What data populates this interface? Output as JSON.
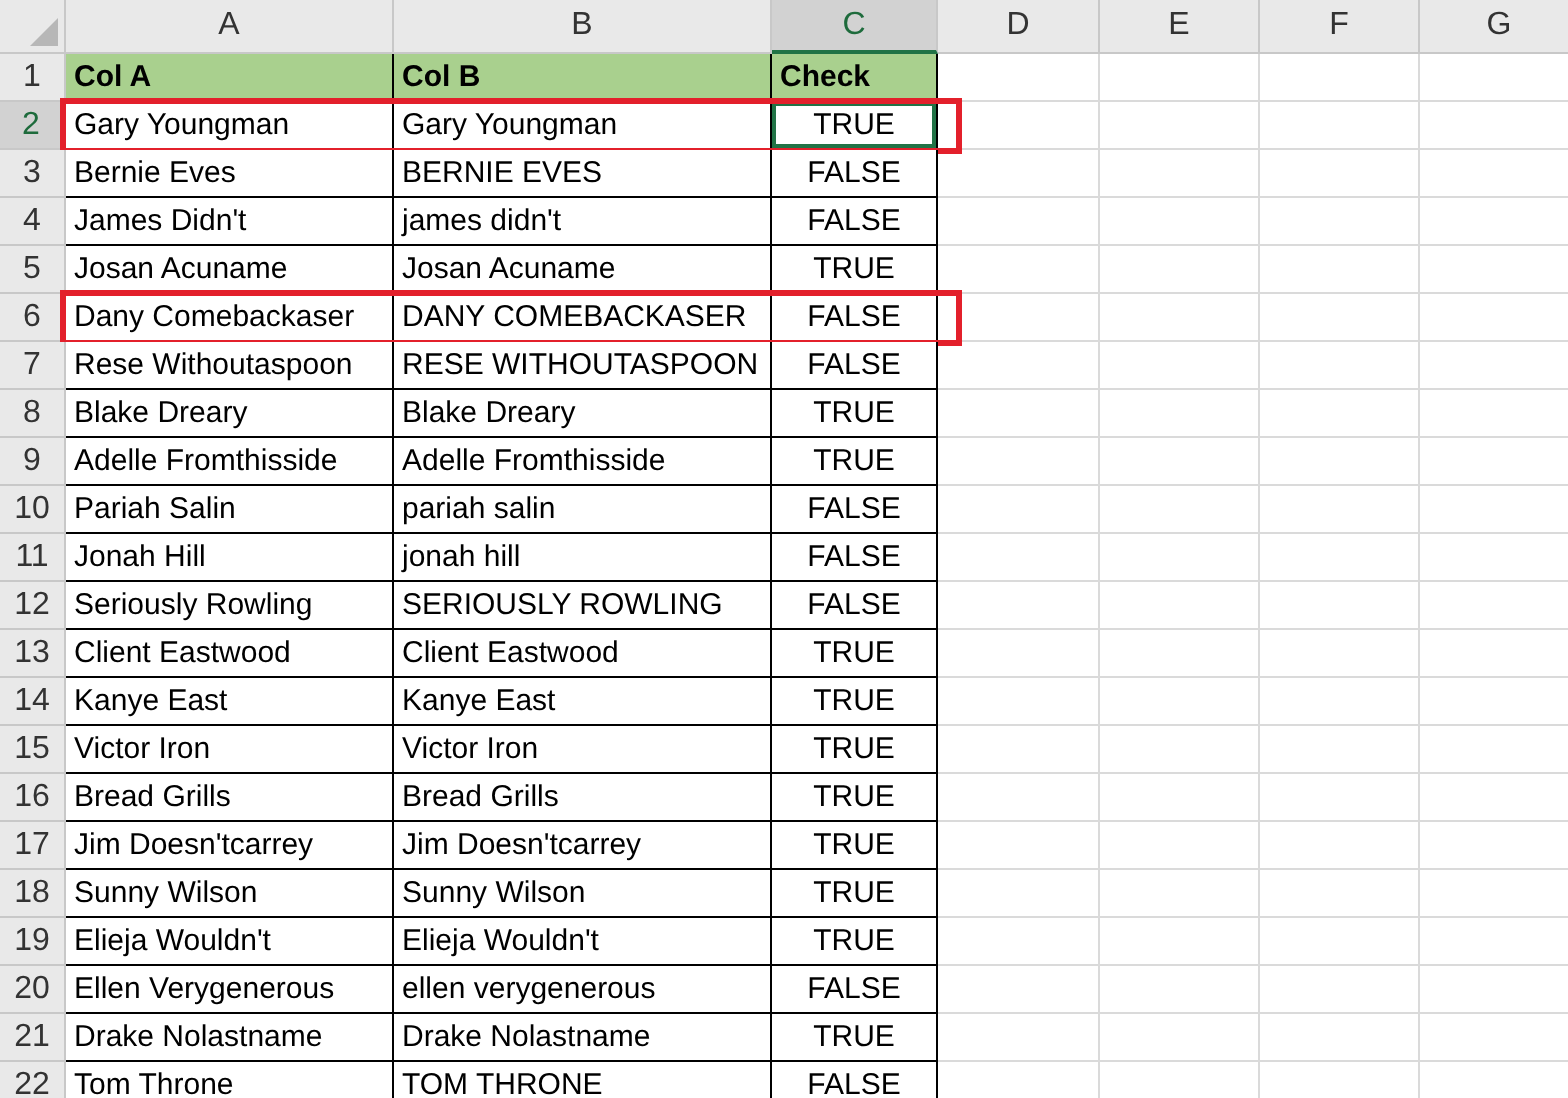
{
  "columns": [
    {
      "label": "A",
      "selected": false
    },
    {
      "label": "B",
      "selected": false
    },
    {
      "label": "C",
      "selected": true
    },
    {
      "label": "D",
      "selected": false
    },
    {
      "label": "E",
      "selected": false
    },
    {
      "label": "F",
      "selected": false
    },
    {
      "label": "G",
      "selected": false
    }
  ],
  "rows": [
    {
      "number": "1",
      "selected": false,
      "outlined": false,
      "kind": "header",
      "cells": [
        "Col A",
        "Col B",
        "Check"
      ]
    },
    {
      "number": "2",
      "selected": true,
      "outlined": true,
      "kind": "data",
      "cells": [
        "Gary Youngman",
        "Gary Youngman",
        "TRUE"
      ]
    },
    {
      "number": "3",
      "selected": false,
      "outlined": false,
      "kind": "data",
      "cells": [
        "Bernie Eves",
        "BERNIE EVES",
        "FALSE"
      ]
    },
    {
      "number": "4",
      "selected": false,
      "outlined": false,
      "kind": "data",
      "cells": [
        "James Didn't",
        "james didn't",
        "FALSE"
      ]
    },
    {
      "number": "5",
      "selected": false,
      "outlined": false,
      "kind": "data",
      "cells": [
        "Josan Acuname",
        "Josan Acuname",
        "TRUE"
      ]
    },
    {
      "number": "6",
      "selected": false,
      "outlined": true,
      "kind": "data",
      "cells": [
        "Dany Comebackaser",
        "DANY COMEBACKASER",
        "FALSE"
      ]
    },
    {
      "number": "7",
      "selected": false,
      "outlined": false,
      "kind": "data",
      "cells": [
        "Rese Withoutaspoon",
        "RESE WITHOUTASPOON",
        "FALSE"
      ]
    },
    {
      "number": "8",
      "selected": false,
      "outlined": false,
      "kind": "data",
      "cells": [
        "Blake Dreary",
        "Blake Dreary",
        "TRUE"
      ]
    },
    {
      "number": "9",
      "selected": false,
      "outlined": false,
      "kind": "data",
      "cells": [
        "Adelle Fromthisside",
        "Adelle Fromthisside",
        "TRUE"
      ]
    },
    {
      "number": "10",
      "selected": false,
      "outlined": false,
      "kind": "data",
      "cells": [
        "Pariah Salin",
        "pariah salin",
        "FALSE"
      ]
    },
    {
      "number": "11",
      "selected": false,
      "outlined": false,
      "kind": "data",
      "cells": [
        "Jonah Hill",
        "jonah hill",
        "FALSE"
      ]
    },
    {
      "number": "12",
      "selected": false,
      "outlined": false,
      "kind": "data",
      "cells": [
        "Seriously Rowling",
        "SERIOUSLY ROWLING",
        "FALSE"
      ]
    },
    {
      "number": "13",
      "selected": false,
      "outlined": false,
      "kind": "data",
      "cells": [
        "Client Eastwood",
        "Client Eastwood",
        "TRUE"
      ]
    },
    {
      "number": "14",
      "selected": false,
      "outlined": false,
      "kind": "data",
      "cells": [
        "Kanye East",
        "Kanye East",
        "TRUE"
      ]
    },
    {
      "number": "15",
      "selected": false,
      "outlined": false,
      "kind": "data",
      "cells": [
        "Victor Iron",
        "Victor Iron",
        "TRUE"
      ]
    },
    {
      "number": "16",
      "selected": false,
      "outlined": false,
      "kind": "data",
      "cells": [
        "Bread Grills",
        "Bread Grills",
        "TRUE"
      ]
    },
    {
      "number": "17",
      "selected": false,
      "outlined": false,
      "kind": "data",
      "cells": [
        "Jim Doesn'tcarrey",
        "Jim Doesn'tcarrey",
        "TRUE"
      ]
    },
    {
      "number": "18",
      "selected": false,
      "outlined": false,
      "kind": "data",
      "cells": [
        "Sunny Wilson",
        "Sunny Wilson",
        "TRUE"
      ]
    },
    {
      "number": "19",
      "selected": false,
      "outlined": false,
      "kind": "data",
      "cells": [
        "Elieja Wouldn't",
        "Elieja Wouldn't",
        "TRUE"
      ]
    },
    {
      "number": "20",
      "selected": false,
      "outlined": false,
      "kind": "data",
      "cells": [
        "Ellen Verygenerous",
        "ellen verygenerous",
        "FALSE"
      ]
    },
    {
      "number": "21",
      "selected": false,
      "outlined": false,
      "kind": "data",
      "cells": [
        "Drake Nolastname",
        "Drake Nolastname",
        "TRUE"
      ]
    },
    {
      "number": "22",
      "selected": false,
      "outlined": false,
      "kind": "data",
      "cells": [
        "Tom Throne",
        "TOM THRONE",
        "FALSE"
      ]
    }
  ]
}
